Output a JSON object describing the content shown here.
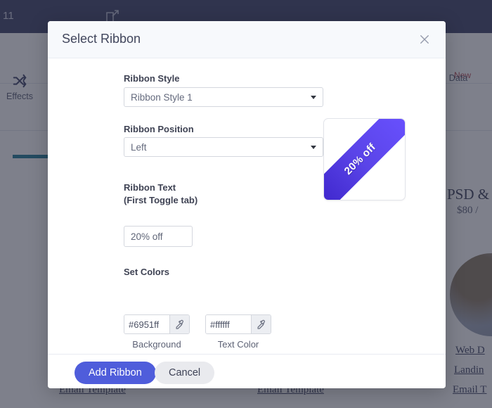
{
  "background": {
    "topbar": {
      "count_label": "11",
      "edit_icon": "edit-square-icon"
    },
    "toolbar": {
      "effects_label": "Effects",
      "effects_icon": "shuffle-icon",
      "data_label": "Data",
      "new_badge": "New"
    },
    "content": {
      "price_title": "PSD &",
      "price_sub": "$80 /",
      "link_web_design": "Web D",
      "link_landing": "Landin",
      "link_email_right": "Email T",
      "link_email_1": "Email Template",
      "link_email_2": "Email Template"
    }
  },
  "modal": {
    "title": "Select Ribbon",
    "close_icon": "close-icon",
    "fields": {
      "ribbon_style": {
        "label": "Ribbon Style",
        "value": "Ribbon Style 1",
        "caret_icon": "chevron-down-icon"
      },
      "ribbon_position": {
        "label": "Ribbon Position",
        "value": "Left",
        "caret_icon": "chevron-down-icon"
      },
      "ribbon_text": {
        "label": "Ribbon Text\n(First Toggle tab)",
        "value": "20% off"
      },
      "set_colors": {
        "label": "Set Colors",
        "background": {
          "value": "#6951ff",
          "caption": "Background",
          "picker_icon": "eyedropper-icon"
        },
        "text": {
          "value": "#ffffff",
          "caption": "Text Color",
          "picker_icon": "eyedropper-icon"
        }
      }
    },
    "preview": {
      "ribbon_text": "20% off",
      "ribbon_color": "#6951ff",
      "text_color": "#ffffff"
    },
    "footer": {
      "primary_label": "Add Ribbon",
      "secondary_label": "Cancel",
      "primary_color": "#4f5ddb"
    }
  }
}
